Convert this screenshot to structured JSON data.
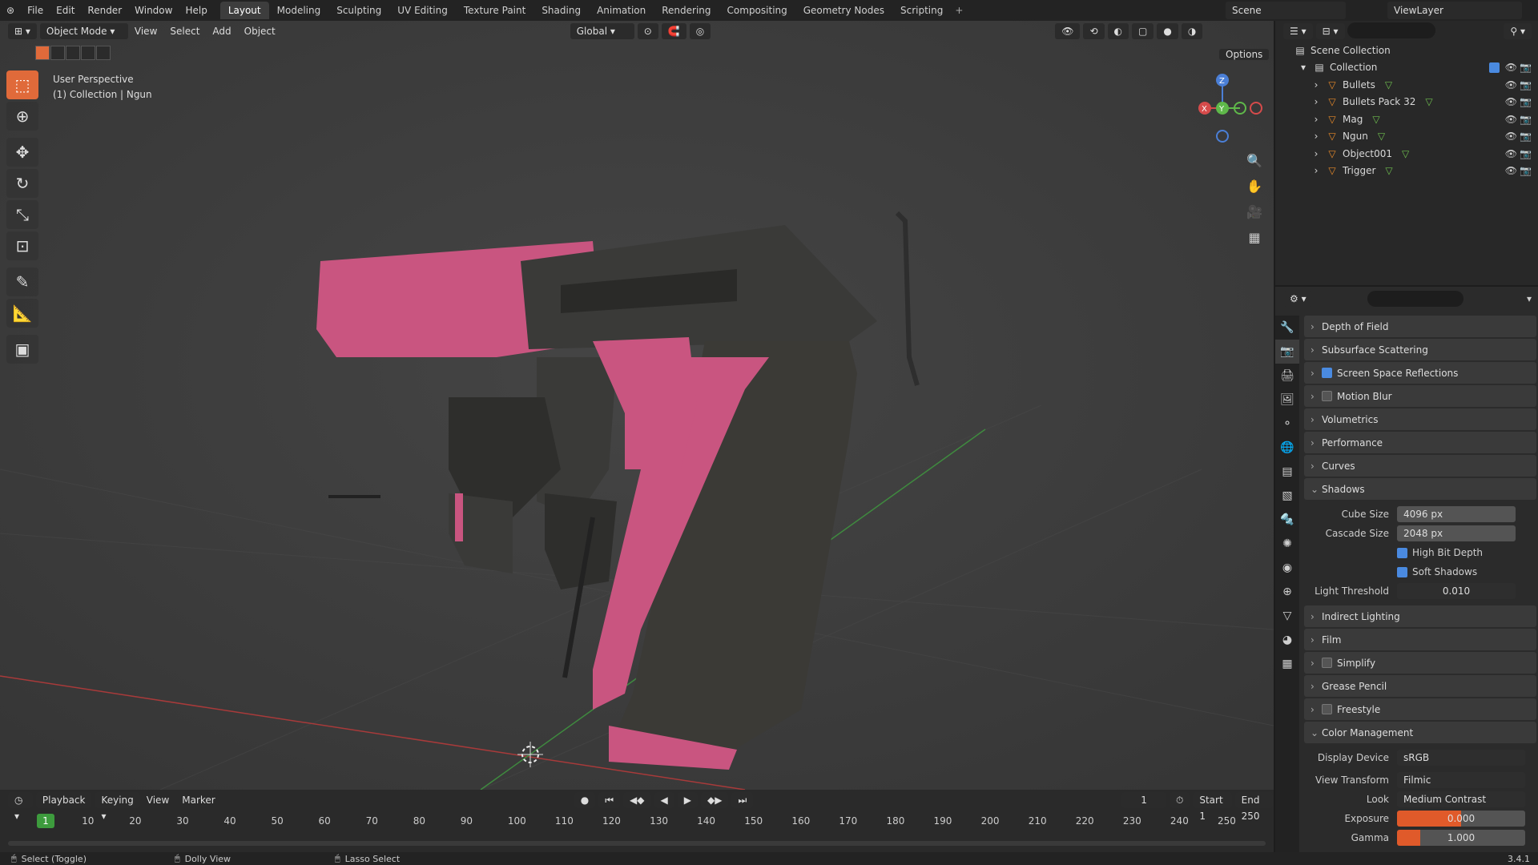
{
  "top_menu": [
    "File",
    "Edit",
    "Render",
    "Window",
    "Help"
  ],
  "workspaces": [
    "Layout",
    "Modeling",
    "Sculpting",
    "UV Editing",
    "Texture Paint",
    "Shading",
    "Animation",
    "Rendering",
    "Compositing",
    "Geometry Nodes",
    "Scripting"
  ],
  "active_workspace": "Layout",
  "scene_name": "Scene",
  "view_layer": "ViewLayer",
  "viewport": {
    "mode": "Object Mode",
    "menus": [
      "View",
      "Select",
      "Add",
      "Object"
    ],
    "orientation": "Global",
    "options": "Options",
    "perspective": "User Perspective",
    "collection_info": "(1) Collection | Ngun",
    "gizmo_axes": {
      "z": "Z",
      "y": "Y",
      "x": "X"
    }
  },
  "outliner": {
    "root": "Scene Collection",
    "collection": "Collection",
    "items": [
      "Bullets",
      "Bullets Pack 32",
      "Mag",
      "Ngun",
      "Object001",
      "Trigger"
    ]
  },
  "properties": {
    "panels_top": [
      "Depth of Field",
      "Subsurface Scattering",
      "Screen Space Reflections",
      "Motion Blur",
      "Volumetrics",
      "Performance",
      "Curves",
      "Shadows"
    ],
    "shadows": {
      "cube_size_label": "Cube Size",
      "cube_size": "4096 px",
      "cascade_size_label": "Cascade Size",
      "cascade_size": "2048 px",
      "high_bit_depth": "High Bit Depth",
      "soft_shadows": "Soft Shadows",
      "light_threshold_label": "Light Threshold",
      "light_threshold": "0.010"
    },
    "panels_bottom": [
      "Indirect Lighting",
      "Film",
      "Simplify",
      "Grease Pencil",
      "Freestyle",
      "Color Management"
    ],
    "color_management": {
      "display_device_label": "Display Device",
      "display_device": "sRGB",
      "view_transform_label": "View Transform",
      "view_transform": "Filmic",
      "look_label": "Look",
      "look": "Medium Contrast",
      "exposure_label": "Exposure",
      "exposure": "0.000",
      "gamma_label": "Gamma",
      "gamma": "1.000"
    }
  },
  "timeline": {
    "menus": [
      "Playback",
      "Keying",
      "View",
      "Marker"
    ],
    "current_frame": "1",
    "start_label": "Start",
    "start": "1",
    "end_label": "End",
    "end": "250",
    "ruler": [
      "10",
      "20",
      "30",
      "40",
      "50",
      "60",
      "70",
      "80",
      "90",
      "100",
      "110",
      "120",
      "130",
      "140",
      "150",
      "160",
      "170",
      "180",
      "190",
      "200",
      "210",
      "220",
      "230",
      "240",
      "250"
    ],
    "cursor_frame": "1"
  },
  "statusbar": {
    "select": "Select (Toggle)",
    "dolly": "Dolly View",
    "lasso": "Lasso Select",
    "version": "3.4.1"
  }
}
